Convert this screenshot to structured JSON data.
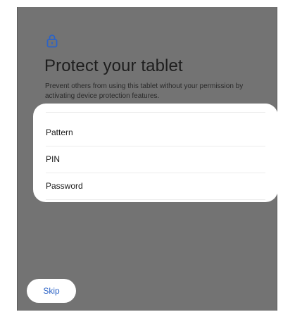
{
  "header": {
    "icon": "lock-icon",
    "title": "Protect your tablet",
    "subtitle": "Prevent others from using this tablet without your permission by activating device protection features."
  },
  "options": [
    {
      "label": "Pattern"
    },
    {
      "label": "PIN"
    },
    {
      "label": "Password"
    }
  ],
  "footer": {
    "skip_label": "Skip"
  },
  "colors": {
    "accent": "#2c63c6",
    "dim_background": "#737373",
    "card": "#ffffff"
  }
}
